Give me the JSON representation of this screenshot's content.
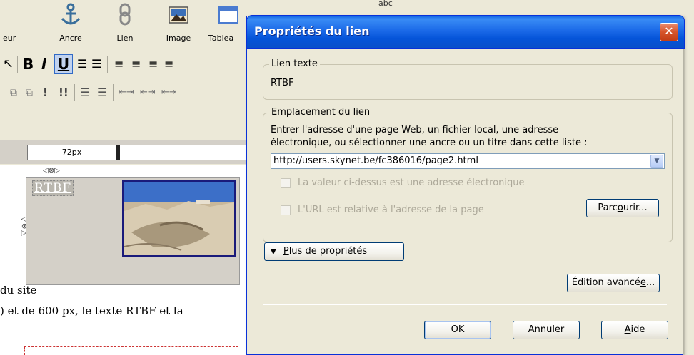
{
  "toolbar": {
    "items": [
      {
        "label": "eur",
        "icon": "text-color-icon"
      },
      {
        "label": "Ancre",
        "icon": "anchor-icon"
      },
      {
        "label": "Lien",
        "icon": "link-icon"
      },
      {
        "label": "Image",
        "icon": "image-icon"
      },
      {
        "label": "Tablea",
        "icon": "table-icon"
      }
    ],
    "top_glimpse_text": "abc",
    "format": {
      "bold": "B",
      "italic": "I",
      "underline": "U",
      "exclaim1": "!",
      "exclaim2": "!!"
    }
  },
  "ruler": {
    "width_label": "72px"
  },
  "canvas": {
    "link_text": "RTBF",
    "line1": "du site",
    "line2": ") et de 600 px, le texte RTBF et la"
  },
  "dialog": {
    "title": "Propriétés du lien",
    "close_glyph": "✕",
    "link_text_group": {
      "legend": "Lien texte",
      "value": "RTBF"
    },
    "location_group": {
      "legend": "Emplacement du lien",
      "instruction_line1": "Entrer l'adresse d'une page Web, un fichier local, une adresse",
      "instruction_line2": "électronique, ou sélectionner une ancre ou un titre dans cette liste :",
      "url": "http://users.skynet.be/fc386016/page2.html",
      "checkbox_email": "La valeur ci-dessus est une adresse électronique",
      "checkbox_relative": "L'URL est relative à l'adresse de la page",
      "browse_pre": "Parc",
      "browse_u": "o",
      "browse_post": "urir..."
    },
    "more_properties": {
      "arrow": "▼",
      "u": "P",
      "rest": "lus de propriétés"
    },
    "advanced_edit": {
      "pre": "Édition avancé",
      "u": "e",
      "post": "..."
    },
    "buttons": {
      "ok": "OK",
      "cancel": "Annuler",
      "help_u": "A",
      "help_rest": "ide"
    }
  },
  "colors": {
    "title_bar": "#1b6ae8",
    "close_button": "#d6542a",
    "dialog_bg": "#ece9d8"
  }
}
